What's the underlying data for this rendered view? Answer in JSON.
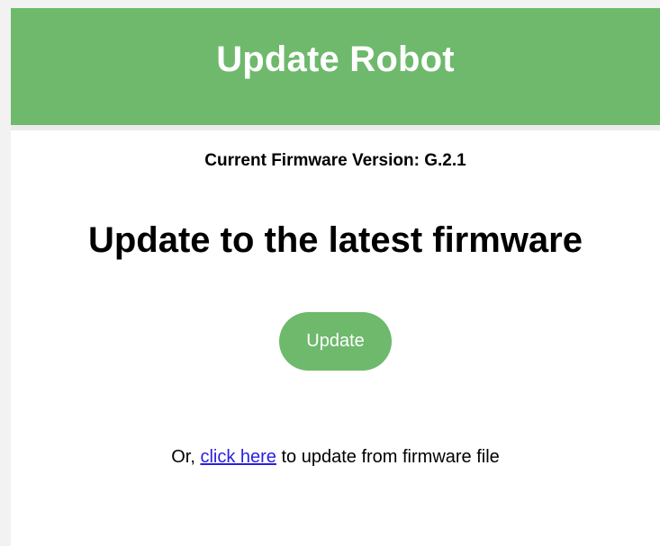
{
  "header": {
    "title": "Update Robot"
  },
  "firmware": {
    "label": "Current Firmware Version: ",
    "version": "G.2.1"
  },
  "main": {
    "heading": "Update to the latest firmware",
    "update_button_label": "Update",
    "alt_prefix": "Or, ",
    "alt_link_text": "click here",
    "alt_suffix": " to update from firmware file"
  },
  "colors": {
    "brand_green": "#6eb96c",
    "link_blue": "#2a1ee0",
    "background": "#ffffff"
  }
}
